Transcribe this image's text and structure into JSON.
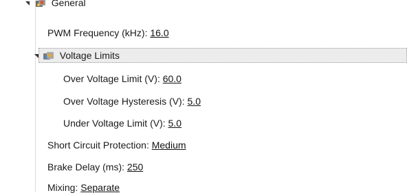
{
  "tree": {
    "general": {
      "label": "General",
      "icon": "gear-group-icon"
    },
    "pwm": {
      "label": "PWM Frequency (kHz):",
      "value": "16.0"
    },
    "voltage_limits": {
      "label": "Voltage Limits",
      "icon": "gear-group-icon",
      "items": [
        {
          "label": "Over Voltage Limit (V):",
          "value": "60.0"
        },
        {
          "label": "Over Voltage Hysteresis (V):",
          "value": "5.0"
        },
        {
          "label": "Under Voltage Limit (V):",
          "value": "5.0"
        }
      ]
    },
    "short_circuit": {
      "label": "Short Circuit Protection:",
      "value": "Medium"
    },
    "brake_delay": {
      "label": "Brake Delay (ms):",
      "value": "250"
    },
    "mixing": {
      "label": "Mixing:",
      "value": "Separate"
    }
  }
}
